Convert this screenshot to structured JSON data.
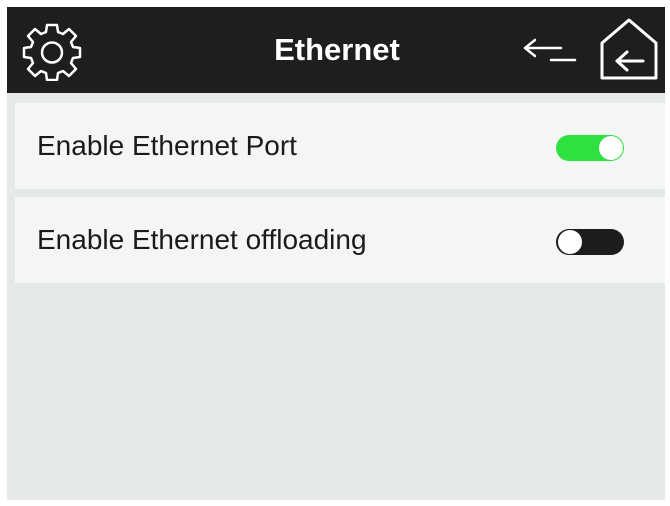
{
  "header": {
    "title": "Ethernet",
    "left_icon": "gear-icon",
    "right_icons": [
      "back-arrow-icon",
      "home-icon"
    ],
    "background": "#1e1e1e",
    "text_color": "#ffffff"
  },
  "settings": [
    {
      "label": "Enable Ethernet Port",
      "enabled": true
    },
    {
      "label": "Enable Ethernet offloading",
      "enabled": false
    }
  ],
  "colors": {
    "toggle_on": "#2ee040",
    "toggle_off": "#1c1c1c",
    "screen_background": "#e5eae7",
    "row_background": "#f4f6f5"
  }
}
